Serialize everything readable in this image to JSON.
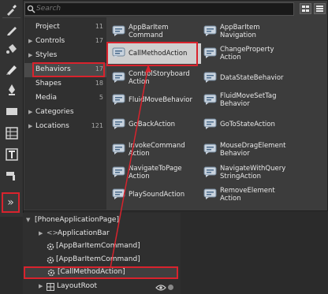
{
  "search": {
    "placeholder": "Search"
  },
  "toolbar": {
    "tools": [
      {
        "name": "pen-icon"
      },
      {
        "name": "paint-bucket-icon"
      },
      {
        "name": "pencil-icon"
      },
      {
        "name": "ink-pen-icon"
      },
      {
        "name": "rectangle-icon"
      },
      {
        "name": "grid-layout-icon"
      },
      {
        "name": "text-icon"
      },
      {
        "name": "brush-icon"
      }
    ],
    "more_icon": "»"
  },
  "categories": [
    {
      "label": "Project",
      "count": "11",
      "expandable": false
    },
    {
      "label": "Controls",
      "count": "17",
      "expandable": true
    },
    {
      "label": "Styles",
      "count": "",
      "expandable": true
    },
    {
      "label": "Behaviors",
      "count": "17",
      "expandable": false
    },
    {
      "label": "Shapes",
      "count": "18",
      "expandable": false
    },
    {
      "label": "Media",
      "count": "5",
      "expandable": false
    },
    {
      "label": "Categories",
      "count": "",
      "expandable": true
    },
    {
      "label": "Locations",
      "count": "121",
      "expandable": true
    }
  ],
  "items": [
    {
      "label": "AppBarItem Command"
    },
    {
      "label": "AppBarItem Navigation"
    },
    {
      "label": "CallMethodAction"
    },
    {
      "label": "ChangeProperty Action"
    },
    {
      "label": "ControlStoryboard Action"
    },
    {
      "label": "DataStateBehavior"
    },
    {
      "label": "FluidMoveBehavior"
    },
    {
      "label": "FluidMoveSetTag Behavior"
    },
    {
      "label": "GoBackAction"
    },
    {
      "label": "GoToStateAction"
    },
    {
      "label": "InvokeCommand Action"
    },
    {
      "label": "MouseDragElement Behavior"
    },
    {
      "label": "NavigateToPage Action"
    },
    {
      "label": "NavigateWithQuery StringAction"
    },
    {
      "label": "PlaySoundAction"
    },
    {
      "label": "RemoveElement Action"
    }
  ],
  "tree": [
    {
      "label": "[PhoneApplicationPage]"
    },
    {
      "label": "ApplicationBar"
    },
    {
      "label": "[AppBarItemCommand]"
    },
    {
      "label": "[AppBarItemCommand]"
    },
    {
      "label": "[CallMethodAction]"
    },
    {
      "label": "LayoutRoot"
    }
  ],
  "colors": {
    "highlight": "#d9232d",
    "panel": "#3c3c3c",
    "selected_item": "#cfcfcf"
  }
}
